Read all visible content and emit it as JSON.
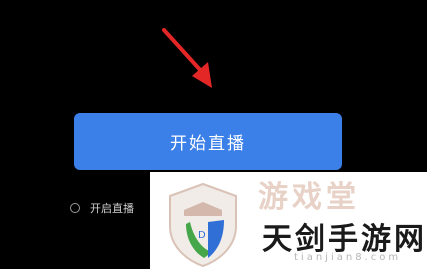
{
  "start_button": {
    "label": "开始直播"
  },
  "option": {
    "label": "开启直播"
  },
  "watermark": {
    "faded_text": "游戏堂",
    "title": "天剑手游网",
    "domain": "tianjian8.com"
  },
  "colors": {
    "background": "#000000",
    "button": "#3b7fe8",
    "arrow": "#e32626"
  }
}
